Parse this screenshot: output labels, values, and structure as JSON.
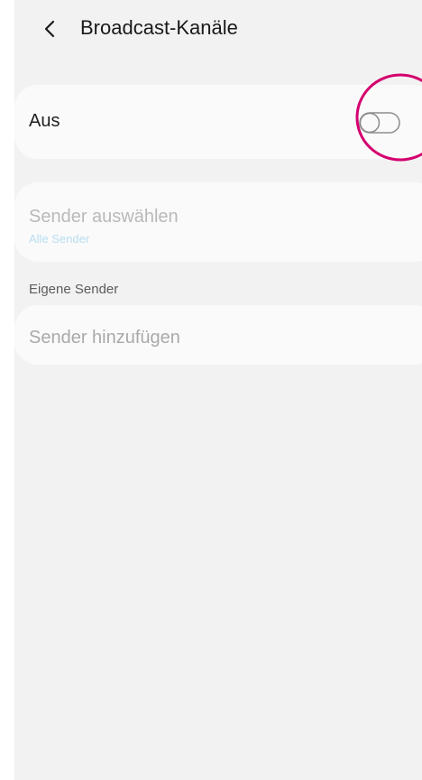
{
  "header": {
    "back_icon": "chevron-left-icon",
    "title": "Broadcast-Kanäle"
  },
  "master_toggle": {
    "label": "Aus",
    "state": "off",
    "highlight_color": "#d4006e"
  },
  "select_channels": {
    "label": "Sender auswählen",
    "summary": "Alle Sender",
    "enabled": false
  },
  "own_channels": {
    "section_title": "Eigene Sender",
    "add_label": "Sender hinzufügen",
    "enabled": false
  }
}
